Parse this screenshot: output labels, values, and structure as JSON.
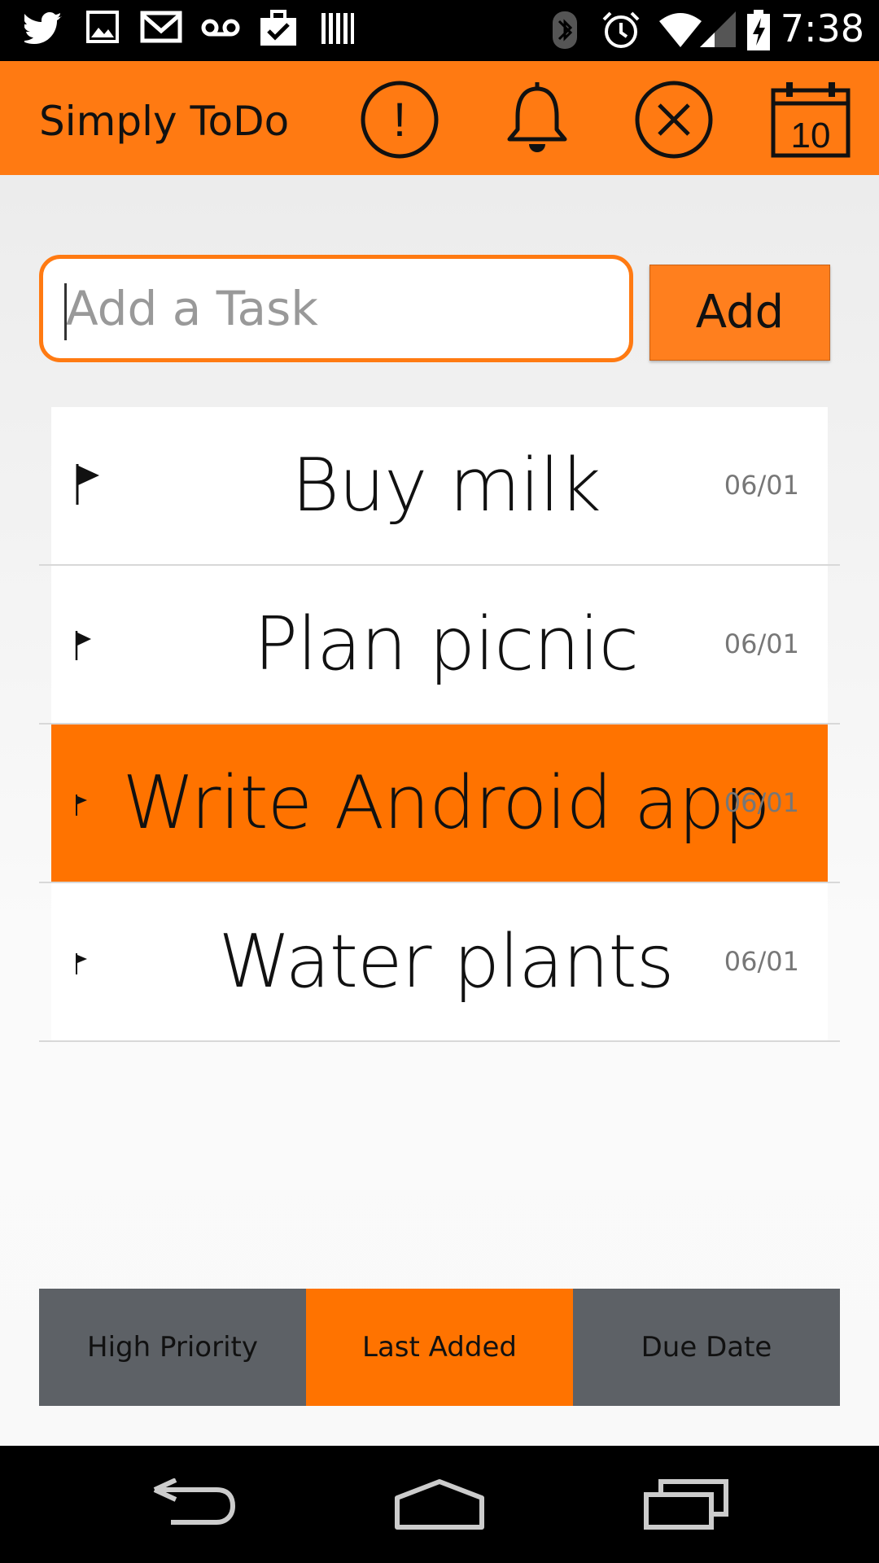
{
  "status_bar": {
    "time": "7:38",
    "left_icons": [
      "twitter-icon",
      "image-icon",
      "gmail-icon",
      "voicemail-icon",
      "briefcase-check-icon",
      "barcode-icon"
    ],
    "right_icons": [
      "bluetooth-icon",
      "alarm-icon",
      "wifi-icon",
      "signal-icon",
      "battery-charging-icon"
    ]
  },
  "action_bar": {
    "title": "Simply ToDo",
    "actions": [
      "priority-icon",
      "bell-icon",
      "clear-icon",
      "calendar-icon"
    ],
    "calendar_day": "10",
    "priority_glyph": "!"
  },
  "add_task": {
    "placeholder": "Add a Task",
    "button_label": "Add"
  },
  "tasks": [
    {
      "title": "Buy milk",
      "date": "06/01",
      "priority": "high",
      "selected": false
    },
    {
      "title": "Plan picnic",
      "date": "06/01",
      "priority": "medium",
      "selected": false
    },
    {
      "title": "Write Android app",
      "date": "06/01",
      "priority": "low",
      "selected": true
    },
    {
      "title": "Water plants",
      "date": "06/01",
      "priority": "low",
      "selected": false
    }
  ],
  "sort_tabs": {
    "high_priority": "High Priority",
    "last_added": "Last Added",
    "due_date": "Due Date",
    "active": "Last Added"
  },
  "colors": {
    "accent": "#ff7a12",
    "selected_row": "#ff7300",
    "tab_inactive": "#5d6166"
  }
}
